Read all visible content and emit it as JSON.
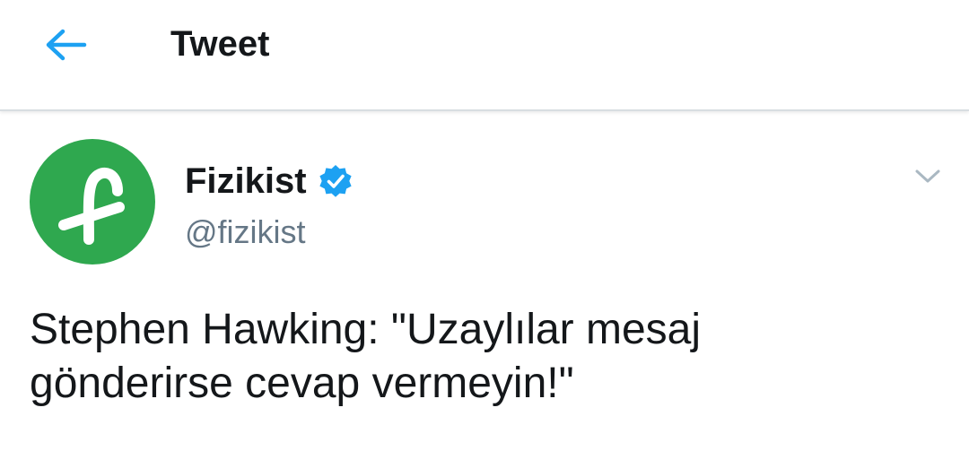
{
  "header": {
    "title": "Tweet",
    "back_icon": "arrow-left-icon",
    "accent_color": "#1da1f2"
  },
  "tweet": {
    "author": {
      "display_name": "Fizikist",
      "handle": "@fizikist",
      "verified": true,
      "avatar_color": "#2fa84f",
      "avatar_icon": "fizikist-logo-icon"
    },
    "menu_icon": "chevron-down-icon",
    "text": "Stephen Hawking: \"Uzaylılar mesaj\ngönderirse cevap vermeyin!\""
  }
}
